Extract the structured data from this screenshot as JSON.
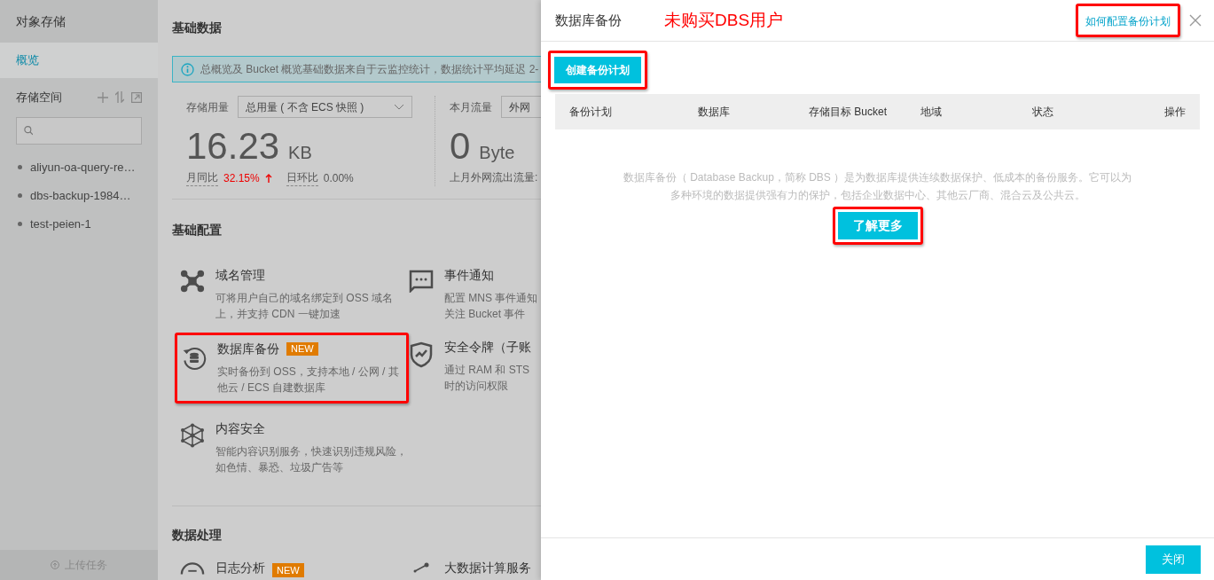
{
  "sidebar": {
    "title": "对象存储",
    "nav": [
      {
        "label": "概览",
        "selected": true
      }
    ],
    "section_title": "存储空间",
    "buckets": [
      "aliyun-oa-query-re…",
      "dbs-backup-1984…",
      "test-peien-1"
    ],
    "footer": "上传任务"
  },
  "main": {
    "basic_data": {
      "heading": "基础数据",
      "notice": "总概览及 Bucket 概览基础数据来自于云监控统计，数据统计平均延迟 2-",
      "storage": {
        "label": "存储用量",
        "select": "总用量 ( 不含 ECS 快照 )",
        "value": "16.23",
        "unit": "KB",
        "mom_label": "月同比",
        "mom_value": "32.15%",
        "dod_label": "日环比",
        "dod_value": "0.00%"
      },
      "traffic": {
        "label": "本月流量",
        "select": "外网",
        "value": "0",
        "unit": "Byte",
        "last_month_label": "上月外网流出流量:"
      }
    },
    "basic_config": {
      "heading": "基础配置",
      "items": [
        {
          "kind": "domain",
          "title": "域名管理",
          "desc": "可将用户自己的域名绑定到 OSS 域名上，并支持 CDN 一键加速",
          "highlighted": false
        },
        {
          "kind": "event",
          "title": "事件通知",
          "desc_lines": [
            "配置 MNS 事件通知",
            "关注 Bucket 事件"
          ],
          "highlighted": false
        },
        {
          "kind": "backup",
          "title": "数据库备份",
          "desc": "实时备份到 OSS，支持本地 / 公网 / 其他云 / ECS 自建数据库",
          "badge": "NEW",
          "highlighted": true
        },
        {
          "kind": "token",
          "title": "安全令牌（子账",
          "desc_lines": [
            "通过 RAM 和 STS",
            "时的访问权限"
          ],
          "highlighted": false
        },
        {
          "kind": "content",
          "title": "内容安全",
          "desc": "智能内容识别服务，快速识别违规风险，如色情、暴恐、垃圾广告等",
          "highlighted": false
        }
      ]
    },
    "data_processing": {
      "heading": "数据处理",
      "items": [
        {
          "kind": "log",
          "title": "日志分析",
          "badge": "NEW"
        },
        {
          "kind": "bigdata",
          "title": "大数据计算服务"
        }
      ]
    }
  },
  "drawer": {
    "title": "数据库备份",
    "annotation": "未购买DBS用户",
    "help_link": "如何配置备份计划",
    "create_button": "创建备份计划",
    "table": {
      "columns": [
        "备份计划",
        "数据库",
        "存储目标 Bucket",
        "地域",
        "状态",
        "操作"
      ]
    },
    "empty_text": "数据库备份（ Database Backup，简称 DBS ）是为数据库提供连续数据保护、低成本的备份服务。它可以为多种环境的数据提供强有力的保护，包括企业数据中心、其他云厂商、混合云及公共云。",
    "learn_more": "了解更多",
    "close_button": "关闭"
  }
}
